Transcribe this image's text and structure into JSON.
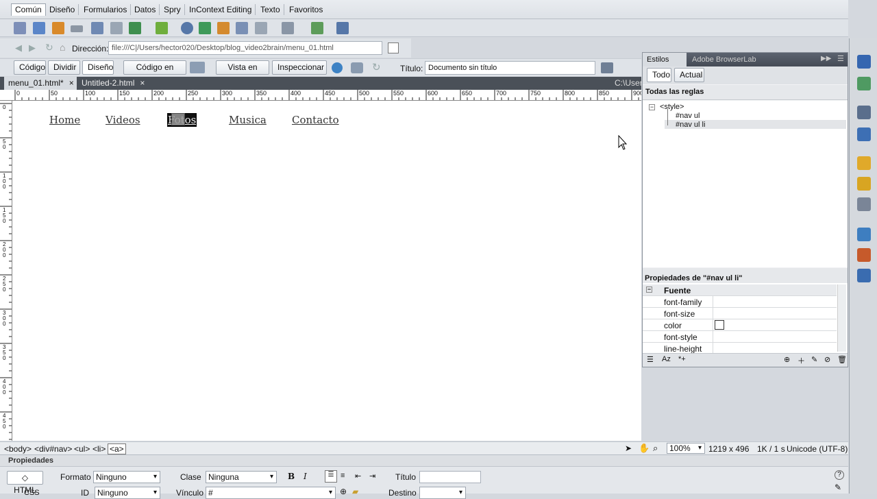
{
  "insert_tabs": [
    "Común",
    "Diseño",
    "Formularios",
    "Datos",
    "Spry",
    "InContext Editing",
    "Texto",
    "Favoritos"
  ],
  "address": {
    "label": "Dirección:",
    "value": "file:///C|/Users/hector020/Desktop/blog_video2brain/menu_01.html"
  },
  "doc_toolbar": {
    "code": "Código",
    "split": "Dividir",
    "design": "Diseño",
    "live_code": "Código en vivo",
    "live_view": "Vista en vivo",
    "inspect": "Inspeccionar",
    "title_label": "Título:",
    "title_value": "Documento sin título"
  },
  "doc_tabs": [
    {
      "label": "menu_01.html*",
      "close": "×"
    },
    {
      "label": "Untitled-2.html",
      "close": "×"
    }
  ],
  "path_hint": "C:\\Users",
  "ruler_top": [
    "0",
    "50",
    "100",
    "150",
    "200",
    "250",
    "300",
    "350",
    "400",
    "450",
    "500",
    "550",
    "600",
    "650",
    "700",
    "750",
    "800",
    "850",
    "900"
  ],
  "ruler_left": [
    "0",
    "50",
    "100",
    "150",
    "200",
    "250",
    "300",
    "350",
    "400",
    "450"
  ],
  "nav": [
    "Home",
    "Videos",
    "Fotos",
    "Musica",
    "Contacto"
  ],
  "tag_selector": [
    "<body>",
    "<div#nav>",
    "<ul>",
    "<li>",
    "<a>"
  ],
  "status": {
    "zoom": "100%",
    "size": "1219 x 496",
    "weight": "1K / 1 s",
    "encoding": "Unicode (UTF-8)"
  },
  "css_panel": {
    "tabs": [
      "Estilos CSS",
      "Adobe BrowserLab"
    ],
    "mode": [
      "Todo",
      "Actual"
    ],
    "all_rules": "Todas las reglas",
    "tree": [
      "<style>",
      "#nav ul",
      "#nav ul li"
    ],
    "props_title": "Propiedades de \"#nav ul li\"",
    "category": "Fuente",
    "props": [
      "font-family",
      "font-size",
      "color",
      "font-style",
      "line-height"
    ]
  },
  "properties": {
    "title": "Propiedades",
    "html": "HTML",
    "css": "CSS",
    "format_label": "Formato",
    "format_value": "Ninguno",
    "class_label": "Clase",
    "class_value": "Ninguna",
    "id_label": "ID",
    "id_value": "Ninguno",
    "link_label": "Vínculo",
    "link_value": "#",
    "title_label": "Título",
    "target_label": "Destino",
    "bold": "B",
    "italic": "I"
  }
}
